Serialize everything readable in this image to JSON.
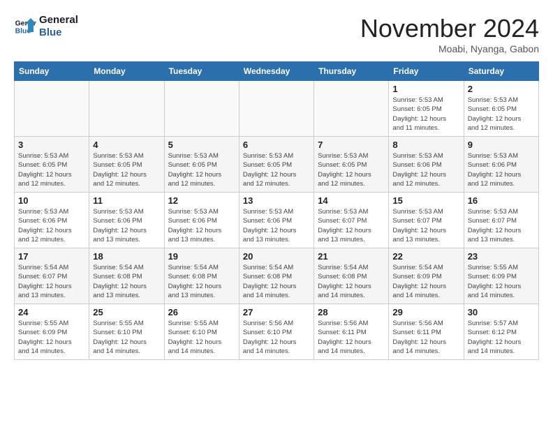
{
  "header": {
    "logo_line1": "General",
    "logo_line2": "Blue",
    "month": "November 2024",
    "location": "Moabi, Nyanga, Gabon"
  },
  "weekdays": [
    "Sunday",
    "Monday",
    "Tuesday",
    "Wednesday",
    "Thursday",
    "Friday",
    "Saturday"
  ],
  "weeks": [
    [
      {
        "day": "",
        "info": ""
      },
      {
        "day": "",
        "info": ""
      },
      {
        "day": "",
        "info": ""
      },
      {
        "day": "",
        "info": ""
      },
      {
        "day": "",
        "info": ""
      },
      {
        "day": "1",
        "info": "Sunrise: 5:53 AM\nSunset: 6:05 PM\nDaylight: 12 hours\nand 11 minutes."
      },
      {
        "day": "2",
        "info": "Sunrise: 5:53 AM\nSunset: 6:05 PM\nDaylight: 12 hours\nand 12 minutes."
      }
    ],
    [
      {
        "day": "3",
        "info": "Sunrise: 5:53 AM\nSunset: 6:05 PM\nDaylight: 12 hours\nand 12 minutes."
      },
      {
        "day": "4",
        "info": "Sunrise: 5:53 AM\nSunset: 6:05 PM\nDaylight: 12 hours\nand 12 minutes."
      },
      {
        "day": "5",
        "info": "Sunrise: 5:53 AM\nSunset: 6:05 PM\nDaylight: 12 hours\nand 12 minutes."
      },
      {
        "day": "6",
        "info": "Sunrise: 5:53 AM\nSunset: 6:05 PM\nDaylight: 12 hours\nand 12 minutes."
      },
      {
        "day": "7",
        "info": "Sunrise: 5:53 AM\nSunset: 6:05 PM\nDaylight: 12 hours\nand 12 minutes."
      },
      {
        "day": "8",
        "info": "Sunrise: 5:53 AM\nSunset: 6:06 PM\nDaylight: 12 hours\nand 12 minutes."
      },
      {
        "day": "9",
        "info": "Sunrise: 5:53 AM\nSunset: 6:06 PM\nDaylight: 12 hours\nand 12 minutes."
      }
    ],
    [
      {
        "day": "10",
        "info": "Sunrise: 5:53 AM\nSunset: 6:06 PM\nDaylight: 12 hours\nand 12 minutes."
      },
      {
        "day": "11",
        "info": "Sunrise: 5:53 AM\nSunset: 6:06 PM\nDaylight: 12 hours\nand 13 minutes."
      },
      {
        "day": "12",
        "info": "Sunrise: 5:53 AM\nSunset: 6:06 PM\nDaylight: 12 hours\nand 13 minutes."
      },
      {
        "day": "13",
        "info": "Sunrise: 5:53 AM\nSunset: 6:06 PM\nDaylight: 12 hours\nand 13 minutes."
      },
      {
        "day": "14",
        "info": "Sunrise: 5:53 AM\nSunset: 6:07 PM\nDaylight: 12 hours\nand 13 minutes."
      },
      {
        "day": "15",
        "info": "Sunrise: 5:53 AM\nSunset: 6:07 PM\nDaylight: 12 hours\nand 13 minutes."
      },
      {
        "day": "16",
        "info": "Sunrise: 5:53 AM\nSunset: 6:07 PM\nDaylight: 12 hours\nand 13 minutes."
      }
    ],
    [
      {
        "day": "17",
        "info": "Sunrise: 5:54 AM\nSunset: 6:07 PM\nDaylight: 12 hours\nand 13 minutes."
      },
      {
        "day": "18",
        "info": "Sunrise: 5:54 AM\nSunset: 6:08 PM\nDaylight: 12 hours\nand 13 minutes."
      },
      {
        "day": "19",
        "info": "Sunrise: 5:54 AM\nSunset: 6:08 PM\nDaylight: 12 hours\nand 13 minutes."
      },
      {
        "day": "20",
        "info": "Sunrise: 5:54 AM\nSunset: 6:08 PM\nDaylight: 12 hours\nand 14 minutes."
      },
      {
        "day": "21",
        "info": "Sunrise: 5:54 AM\nSunset: 6:08 PM\nDaylight: 12 hours\nand 14 minutes."
      },
      {
        "day": "22",
        "info": "Sunrise: 5:54 AM\nSunset: 6:09 PM\nDaylight: 12 hours\nand 14 minutes."
      },
      {
        "day": "23",
        "info": "Sunrise: 5:55 AM\nSunset: 6:09 PM\nDaylight: 12 hours\nand 14 minutes."
      }
    ],
    [
      {
        "day": "24",
        "info": "Sunrise: 5:55 AM\nSunset: 6:09 PM\nDaylight: 12 hours\nand 14 minutes."
      },
      {
        "day": "25",
        "info": "Sunrise: 5:55 AM\nSunset: 6:10 PM\nDaylight: 12 hours\nand 14 minutes."
      },
      {
        "day": "26",
        "info": "Sunrise: 5:55 AM\nSunset: 6:10 PM\nDaylight: 12 hours\nand 14 minutes."
      },
      {
        "day": "27",
        "info": "Sunrise: 5:56 AM\nSunset: 6:10 PM\nDaylight: 12 hours\nand 14 minutes."
      },
      {
        "day": "28",
        "info": "Sunrise: 5:56 AM\nSunset: 6:11 PM\nDaylight: 12 hours\nand 14 minutes."
      },
      {
        "day": "29",
        "info": "Sunrise: 5:56 AM\nSunset: 6:11 PM\nDaylight: 12 hours\nand 14 minutes."
      },
      {
        "day": "30",
        "info": "Sunrise: 5:57 AM\nSunset: 6:12 PM\nDaylight: 12 hours\nand 14 minutes."
      }
    ]
  ]
}
